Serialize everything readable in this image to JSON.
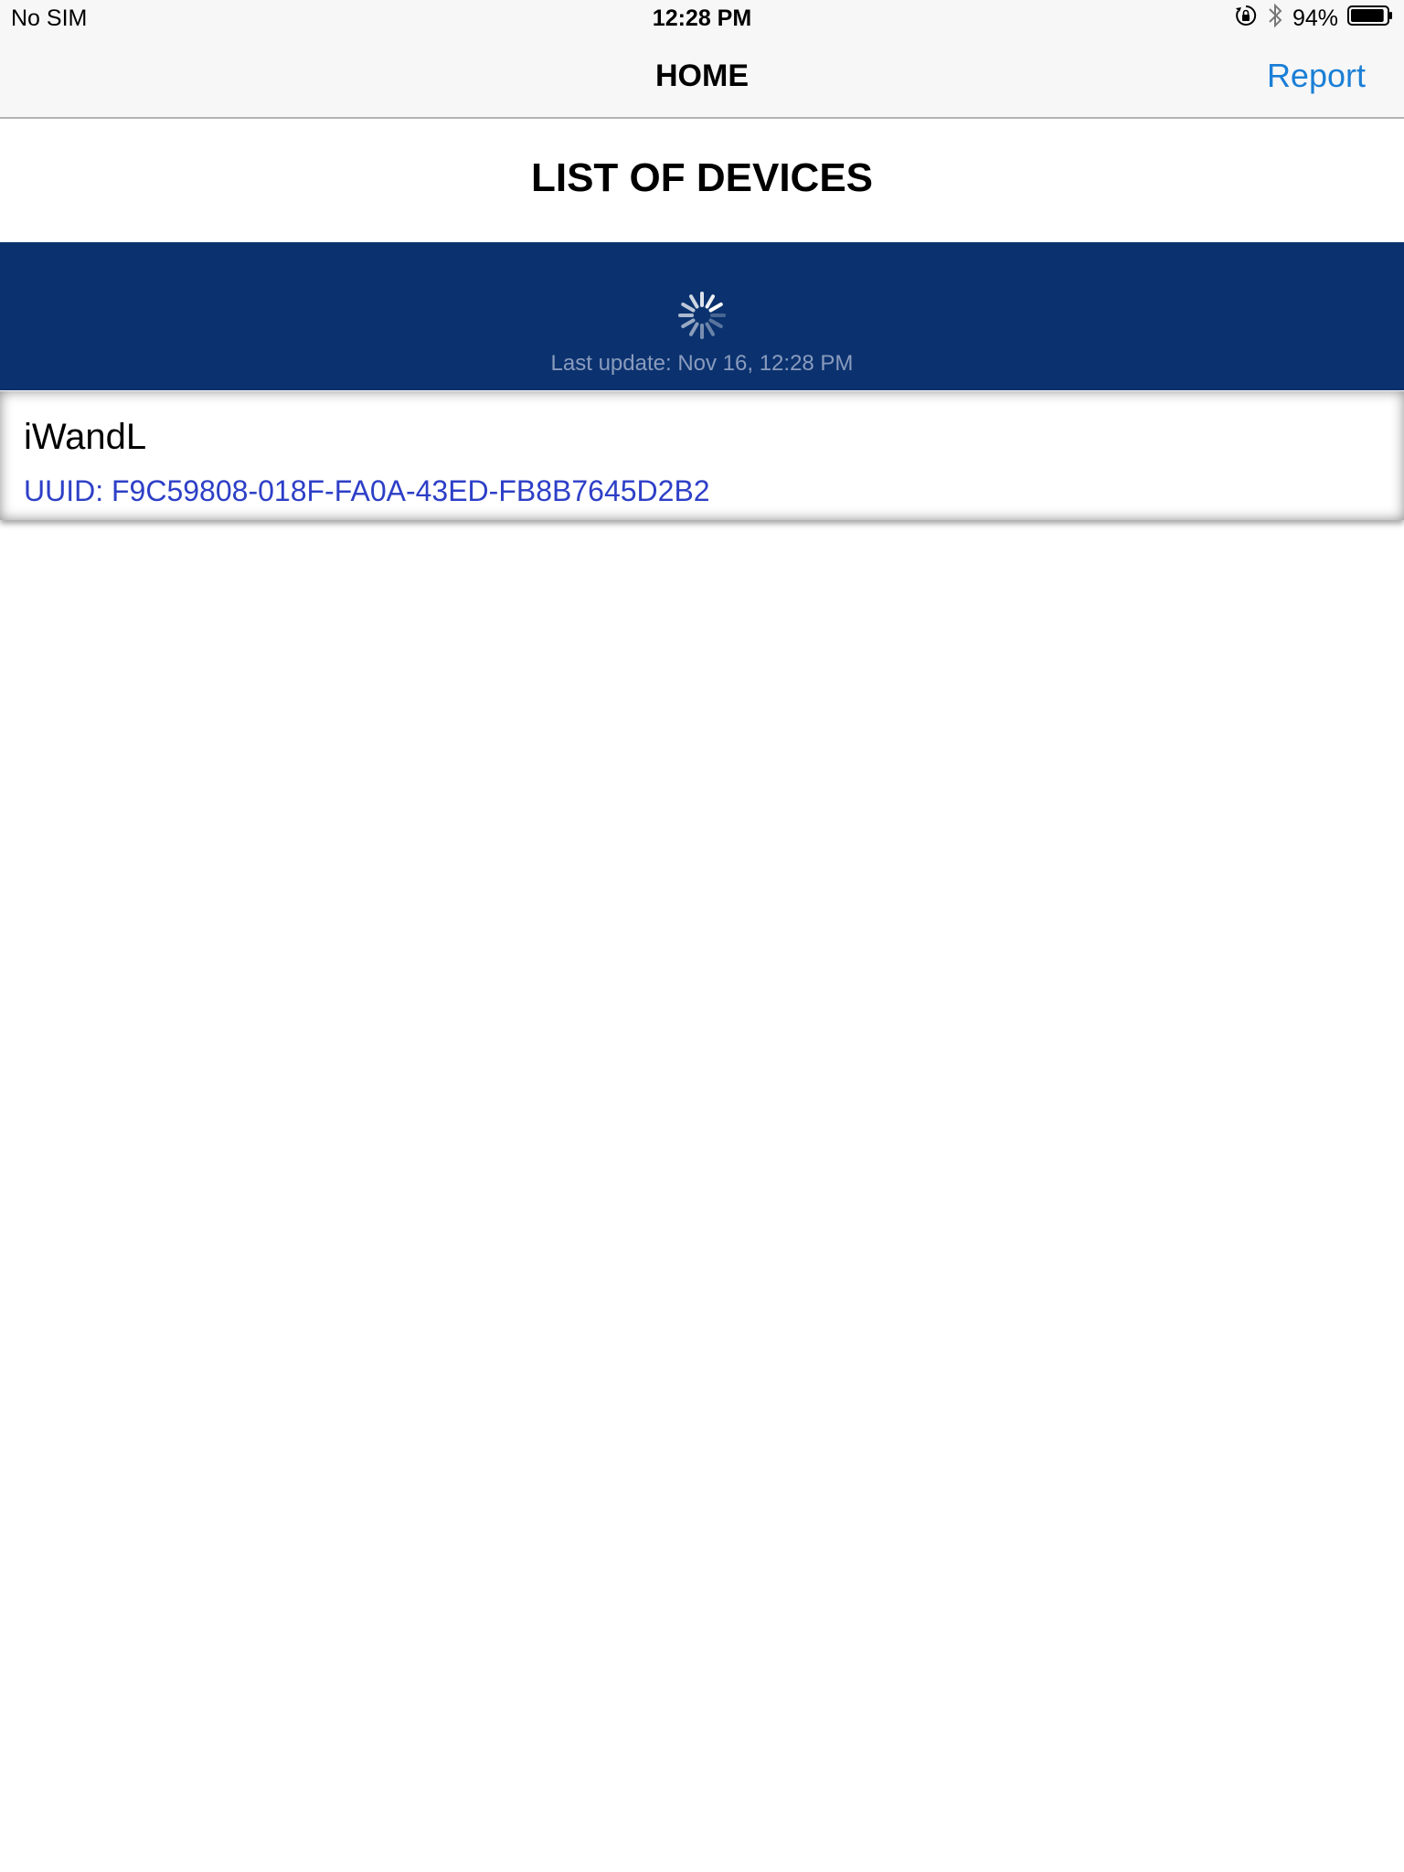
{
  "status_bar": {
    "carrier": "No SIM",
    "time": "12:28 PM",
    "battery_percent": "94%",
    "battery_level": 0.94,
    "icons": [
      "rotation-lock-icon",
      "bluetooth-icon",
      "battery-icon"
    ]
  },
  "nav": {
    "title": "HOME",
    "report_label": "Report"
  },
  "page": {
    "section_title": "LIST OF DEVICES"
  },
  "refresh": {
    "last_update": "Last update: Nov 16, 12:28 PM",
    "icon": "loading-spinner-icon"
  },
  "devices": [
    {
      "name": "iWandL",
      "uuid": "UUID: F9C59808-018F-FA0A-43ED-FB8B7645D2B2"
    }
  ],
  "colors": {
    "accent": "#1b7fd6",
    "refresh_bar": "#0b326f",
    "uuid_text": "#2d3fc7"
  }
}
